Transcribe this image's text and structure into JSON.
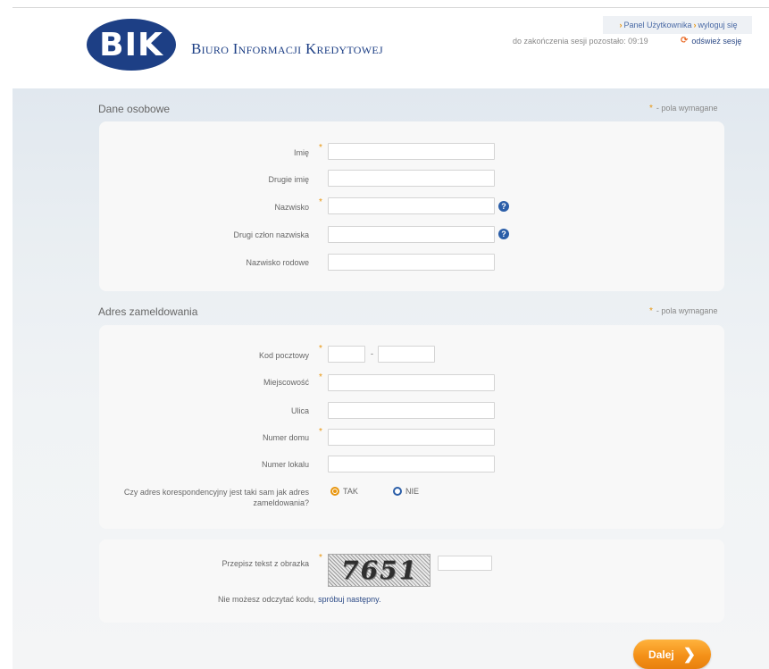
{
  "header": {
    "logo_text": "BIK",
    "org_name": "Biuro Informacji Kredytowej",
    "user_panel_link": "Panel Użytkownika",
    "logout_link": "wyloguj się",
    "session_text": "do zakończenia sesji pozostało: 09:19",
    "refresh_link": "odśwież sesję"
  },
  "personal": {
    "title": "Dane osobowe",
    "required_note": "- pola wymagane",
    "fields": {
      "first_name": "Imię",
      "middle_name": "Drugie imię",
      "last_name": "Nazwisko",
      "last_name_part2": "Drugi człon nazwiska",
      "maiden_name": "Nazwisko rodowe"
    }
  },
  "address": {
    "title": "Adres zameldowania",
    "required_note": "- pola wymagane",
    "fields": {
      "postal_code": "Kod pocztowy",
      "postal_sep": "-",
      "city": "Miejscowość",
      "street": "Ulica",
      "house_no": "Numer domu",
      "flat_no": "Numer lokalu"
    },
    "correspondence_q1": "Czy adres korespondencyjny jest taki sam jak adres",
    "correspondence_q2": "zameldowania?",
    "option_yes": "TAK",
    "option_no": "NIE",
    "selected": "TAK"
  },
  "captcha": {
    "label": "Przepisz tekst z obrazka",
    "image_text": "7651",
    "help_text": "Nie możesz odczytać kodu,",
    "help_link": "spróbuj następny."
  },
  "actions": {
    "next_label": "Dalej"
  },
  "colors": {
    "brand_blue": "#1d3f85",
    "accent_orange": "#f49118",
    "help_blue": "#2b5ea8"
  }
}
